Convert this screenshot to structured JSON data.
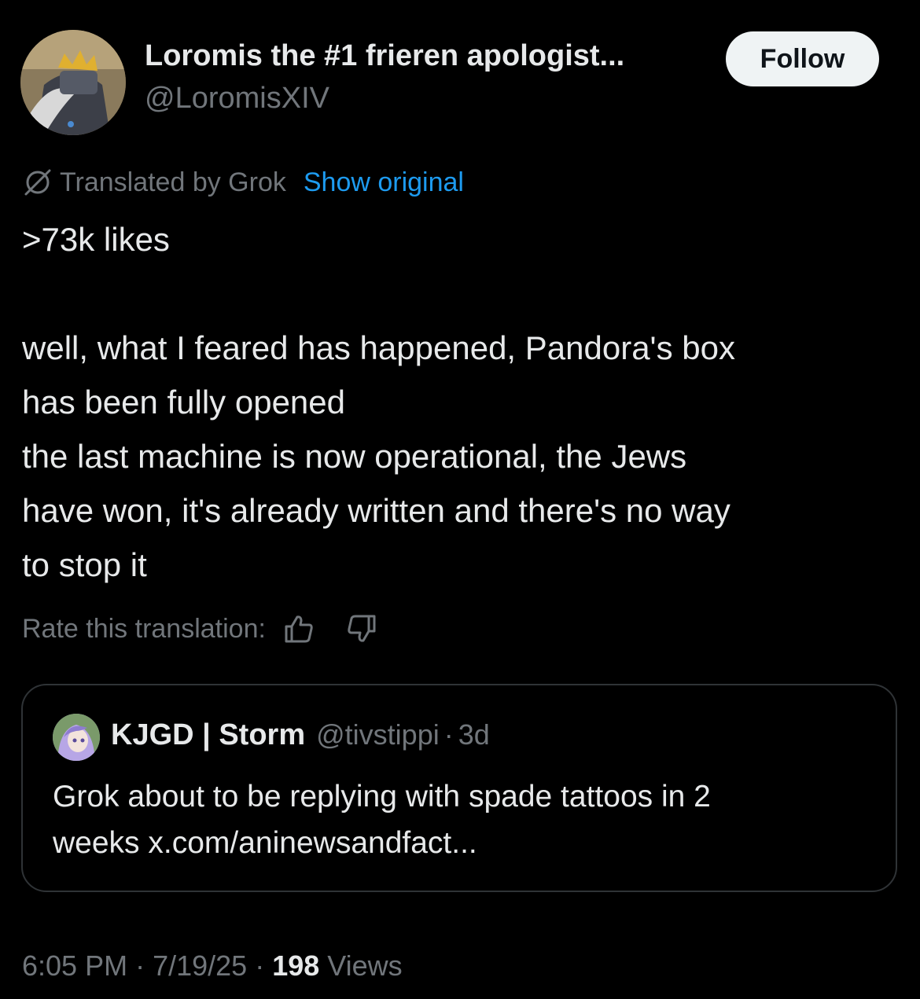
{
  "author": {
    "display_name": "Loromis the #1 frieren apologist...",
    "handle": "@LoromisXIV"
  },
  "follow_label": "Follow",
  "translation": {
    "label": "Translated by Grok",
    "show_original": "Show original"
  },
  "tweet": {
    "lines": [
      ">73k likes",
      "",
      "well, what I feared has happened, Pandora's box",
      "has been fully opened",
      "the last machine is now operational, the Jews",
      "have won, it's already written and there's no way",
      "to stop it"
    ]
  },
  "rate": {
    "label": "Rate this translation:",
    "up_icon": "thumbs-up-icon",
    "down_icon": "thumbs-down-icon"
  },
  "quote": {
    "name": "KJGD | Storm",
    "handle": "@tivstippi",
    "separator": "·",
    "time": "3d",
    "lines": [
      "Grok about to be replying with spade tattoos in 2",
      "weeks x.com/aninewsandfact..."
    ]
  },
  "footer": {
    "time": "6:05 PM",
    "separator": "·",
    "date": "7/19/25",
    "views_count": "198",
    "views_label": "Views"
  },
  "colors": {
    "background": "#000000",
    "text": "#e7e9ea",
    "muted": "#71767b",
    "link": "#1d9bf0",
    "border": "#2f3336",
    "button_bg": "#eff3f4"
  }
}
